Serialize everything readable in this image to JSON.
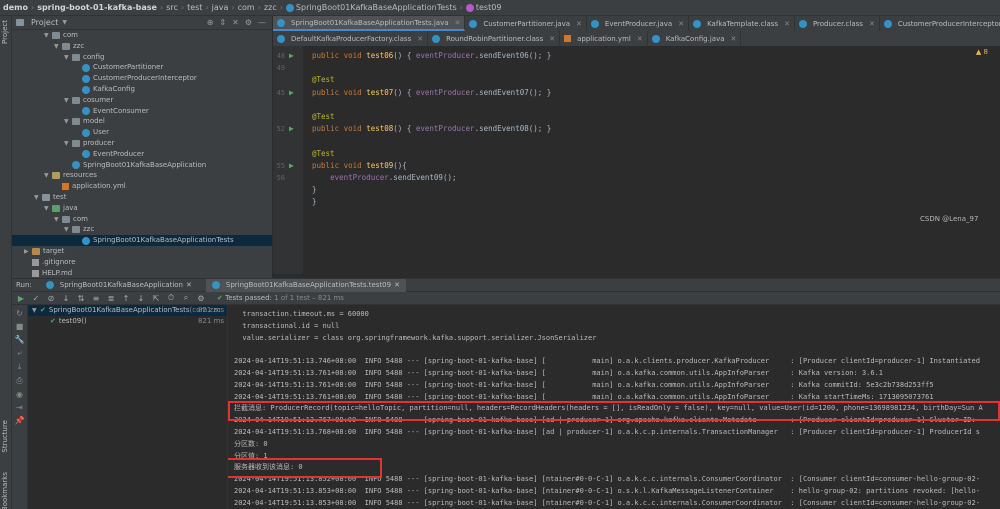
{
  "breadcrumb": [
    "demo",
    "spring-boot-01-kafka-base",
    "src",
    "test",
    "java",
    "com",
    "zzc",
    "SpringBoot01KafkaBaseApplicationTests",
    "test09"
  ],
  "left_strip": {
    "project_label": "Project",
    "structure_label": "Structure",
    "bookmarks_label": "Bookmarks"
  },
  "project_panel": {
    "title": "Project",
    "tree": [
      {
        "label": "com",
        "indent": 3,
        "type": "pkg",
        "open": true
      },
      {
        "label": "zzc",
        "indent": 4,
        "type": "pkg",
        "open": true
      },
      {
        "label": "config",
        "indent": 5,
        "type": "pkg",
        "open": true
      },
      {
        "label": "CustomerPartitioner",
        "indent": 6,
        "type": "cls"
      },
      {
        "label": "CustomerProducerInterceptor",
        "indent": 6,
        "type": "cls"
      },
      {
        "label": "KafkaConfig",
        "indent": 6,
        "type": "cls"
      },
      {
        "label": "cosumer",
        "indent": 5,
        "type": "pkg",
        "open": true
      },
      {
        "label": "EventConsumer",
        "indent": 6,
        "type": "cls"
      },
      {
        "label": "model",
        "indent": 5,
        "type": "pkg",
        "open": true
      },
      {
        "label": "User",
        "indent": 6,
        "type": "cls"
      },
      {
        "label": "producer",
        "indent": 5,
        "type": "pkg",
        "open": true
      },
      {
        "label": "EventProducer",
        "indent": 6,
        "type": "cls"
      },
      {
        "label": "SpringBoot01KafkaBaseApplication",
        "indent": 5,
        "type": "cls"
      },
      {
        "label": "resources",
        "indent": 3,
        "type": "res",
        "open": true
      },
      {
        "label": "application.yml",
        "indent": 4,
        "type": "yml"
      },
      {
        "label": "test",
        "indent": 2,
        "type": "folder",
        "open": true
      },
      {
        "label": "java",
        "indent": 3,
        "type": "test",
        "open": true
      },
      {
        "label": "com",
        "indent": 4,
        "type": "pkg",
        "open": true
      },
      {
        "label": "zzc",
        "indent": 5,
        "type": "pkg",
        "open": true
      },
      {
        "label": "SpringBoot01KafkaBaseApplicationTests",
        "indent": 6,
        "type": "cls",
        "selected": true
      },
      {
        "label": "target",
        "indent": 1,
        "type": "target",
        "open": false
      },
      {
        "label": ".gitignore",
        "indent": 1,
        "type": "file"
      },
      {
        "label": "HELP.md",
        "indent": 1,
        "type": "file"
      }
    ]
  },
  "tabs_row1": [
    {
      "label": "SpringBoot01KafkaBaseApplicationTests.java",
      "active": true
    },
    {
      "label": "CustomerPartitioner.java"
    },
    {
      "label": "EventProducer.java"
    },
    {
      "label": "KafkaTemplate.class"
    },
    {
      "label": "Producer.class"
    },
    {
      "label": "CustomerProducerInterceptor.java"
    }
  ],
  "tabs_row2": [
    {
      "label": "DefaultKafkaProducerFactory.class"
    },
    {
      "label": "RoundRobinPartitioner.class"
    },
    {
      "label": "application.yml"
    },
    {
      "label": "KafkaConfig.java"
    }
  ],
  "editor": {
    "warning_count": "8",
    "lines": [
      {
        "n": "48",
        "run": true,
        "code": [
          [
            "kw",
            "public "
          ],
          [
            "kw",
            "void "
          ],
          [
            "fn",
            "test06"
          ],
          [
            "",
            "() { "
          ],
          [
            "fld",
            "eventProducer"
          ],
          [
            "",
            ".sendEvent06(); }"
          ]
        ]
      },
      {
        "n": "49",
        "code": []
      },
      {
        "n": "",
        "code": [
          [
            "ann",
            "@Test"
          ]
        ]
      },
      {
        "n": "45",
        "run": true,
        "code": [
          [
            "kw",
            "public "
          ],
          [
            "kw",
            "void "
          ],
          [
            "fn",
            "test07"
          ],
          [
            "",
            "() { "
          ],
          [
            "fld",
            "eventProducer"
          ],
          [
            "",
            ".sendEvent07(); }"
          ]
        ]
      },
      {
        "n": "",
        "code": []
      },
      {
        "n": "",
        "code": [
          [
            "ann",
            "@Test"
          ]
        ]
      },
      {
        "n": "52",
        "run": true,
        "code": [
          [
            "kw",
            "public "
          ],
          [
            "kw",
            "void "
          ],
          [
            "fn",
            "test08"
          ],
          [
            "",
            "() { "
          ],
          [
            "fld",
            "eventProducer"
          ],
          [
            "",
            ".sendEvent08(); }"
          ]
        ]
      },
      {
        "n": "",
        "code": []
      },
      {
        "n": "",
        "code": [
          [
            "ann",
            "@Test"
          ]
        ]
      },
      {
        "n": "55",
        "run": true,
        "code": [
          [
            "kw",
            "public "
          ],
          [
            "kw",
            "void "
          ],
          [
            "fn",
            "test09"
          ],
          [
            "",
            "(){"
          ]
        ]
      },
      {
        "n": "56",
        "code": [
          [
            "",
            "    "
          ],
          [
            "fld",
            "eventProducer"
          ],
          [
            "",
            ".sendEvent09();"
          ]
        ]
      },
      {
        "n": "",
        "code": [
          [
            "",
            "}"
          ]
        ]
      },
      {
        "n": "",
        "code": [
          [
            "",
            "}"
          ]
        ]
      }
    ]
  },
  "run_panel": {
    "label": "Run:",
    "tabs": [
      "SpringBoot01KafkaBaseApplication",
      "SpringBoot01KafkaBaseApplicationTests.test09"
    ],
    "status": "Tests passed:",
    "status_detail": "1 of 1 test – 821 ms",
    "tree": [
      {
        "label": "SpringBoot01KafkaBaseApplicationTests",
        "pkg": "(com.zzc",
        "time": "821 ms"
      },
      {
        "label": "test09()",
        "time": "821 ms"
      }
    ]
  },
  "console_lines": [
    "  transaction.timeout.ms = 60000",
    "  transactional.id = null",
    "  value.serializer = class org.springframework.kafka.support.serializer.JsonSerializer",
    "",
    "2024-04-14T19:51:13.746+08:00  INFO 5488 --- [spring-boot-01-kafka-base] [           main] o.a.k.clients.producer.KafkaProducer     : [Producer clientId=producer-1] Instantiated",
    "2024-04-14T19:51:13.761+08:00  INFO 5488 --- [spring-boot-01-kafka-base] [           main] o.a.kafka.common.utils.AppInfoParser     : Kafka version: 3.6.1",
    "2024-04-14T19:51:13.761+08:00  INFO 5488 --- [spring-boot-01-kafka-base] [           main] o.a.kafka.common.utils.AppInfoParser     : Kafka commitId: 5e3c2b738d253ff5",
    "2024-04-14T19:51:13.761+08:00  INFO 5488 --- [spring-boot-01-kafka-base] [           main] o.a.kafka.common.utils.AppInfoParser     : Kafka startTimeMs: 1713095073761",
    "拦截消息: ProducerRecord(topic=helloTopic, partition=null, headers=RecordHeaders(headers = [], isReadOnly = false), key=null, value=User(id=1200, phone=13698981234, birthDay=Sun A",
    "2024-04-14T19:51:13.767+08:00  INFO 5488 --- [spring-boot-01-kafka-base] [ad | producer-1] org.apache.kafka.clients.Metadata        : [Producer clientId=producer-1] Cluster ID:",
    "2024-04-14T19:51:13.768+08:00  INFO 5488 --- [spring-boot-01-kafka-base] [ad | producer-1] o.a.k.c.p.internals.TransactionManager   : [Producer clientId=producer-1] ProducerId s",
    "分区数: 0",
    "分区值: 1",
    "服务器收到该消息: 0",
    "2024-04-14T19:51:13.852+08:00  INFO 5488 --- [spring-boot-01-kafka-base] [ntainer#0-0-C-1] o.a.k.c.c.internals.ConsumerCoordinator  : [Consumer clientId=consumer-hello-group-02-",
    "2024-04-14T19:51:13.853+08:00  INFO 5488 --- [spring-boot-01-kafka-base] [ntainer#0-0-C-1] o.s.k.l.KafkaMessageListenerContainer    : hello-group-02: partitions revoked: [hello-",
    "2024-04-14T19:51:13.853+08:00  INFO 5488 --- [spring-boot-01-kafka-base] [ntainer#0-0-C-1] o.a.k.c.c.internals.ConsumerCoordinator  : [Consumer clientId=consumer-hello-group-02-"
  ],
  "watermark": "CSDN @Lena_97"
}
